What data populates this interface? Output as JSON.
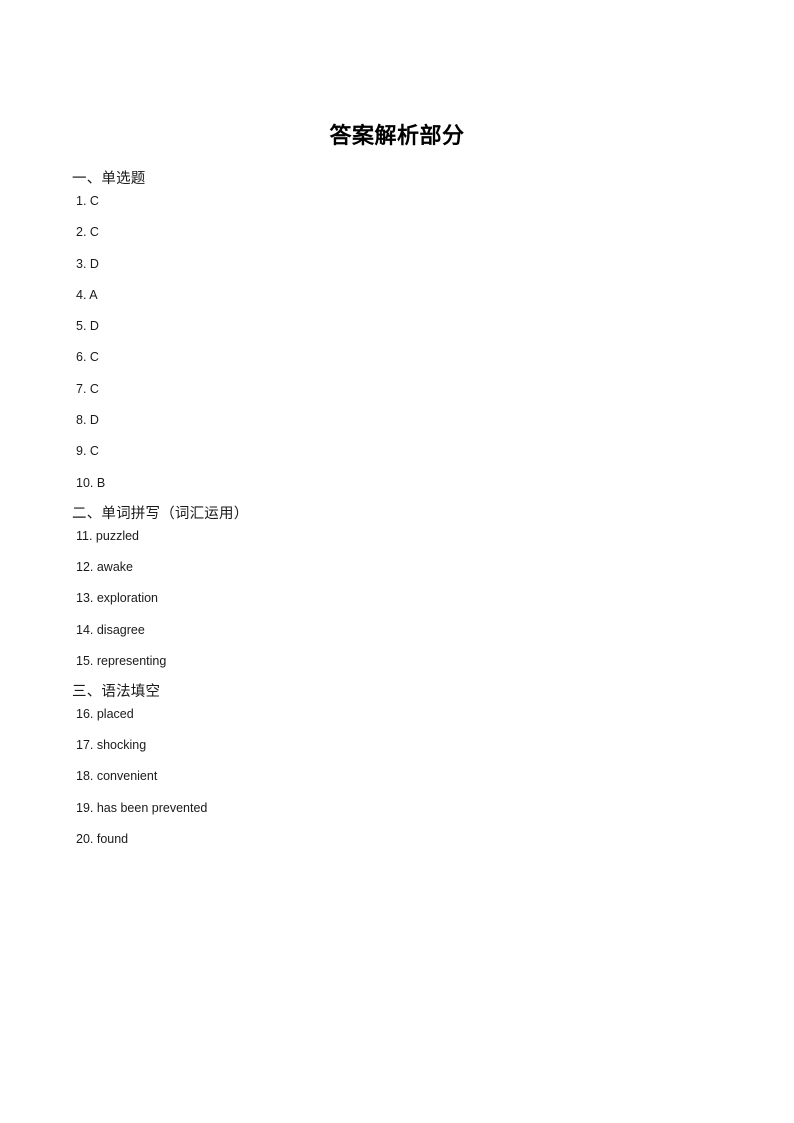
{
  "document": {
    "title": "答案解析部分",
    "sections": [
      {
        "header": "一、单选题",
        "items": [
          "1. C",
          "2. C",
          "3. D",
          "4. A",
          "5. D",
          "6. C",
          "7. C",
          "8. D",
          "9. C",
          "10. B"
        ]
      },
      {
        "header": "二、单词拼写（词汇运用）",
        "items": [
          "11. puzzled",
          "12. awake",
          "13. exploration",
          "14. disagree",
          "15. representing"
        ]
      },
      {
        "header": "三、语法填空",
        "items": [
          "16. placed",
          "17. shocking",
          "18. convenient",
          "19. has been prevented",
          "20. found"
        ]
      }
    ]
  },
  "colors": {
    "page_background": "#ffffff",
    "text": "#1a1a1a",
    "title": "#000000"
  }
}
